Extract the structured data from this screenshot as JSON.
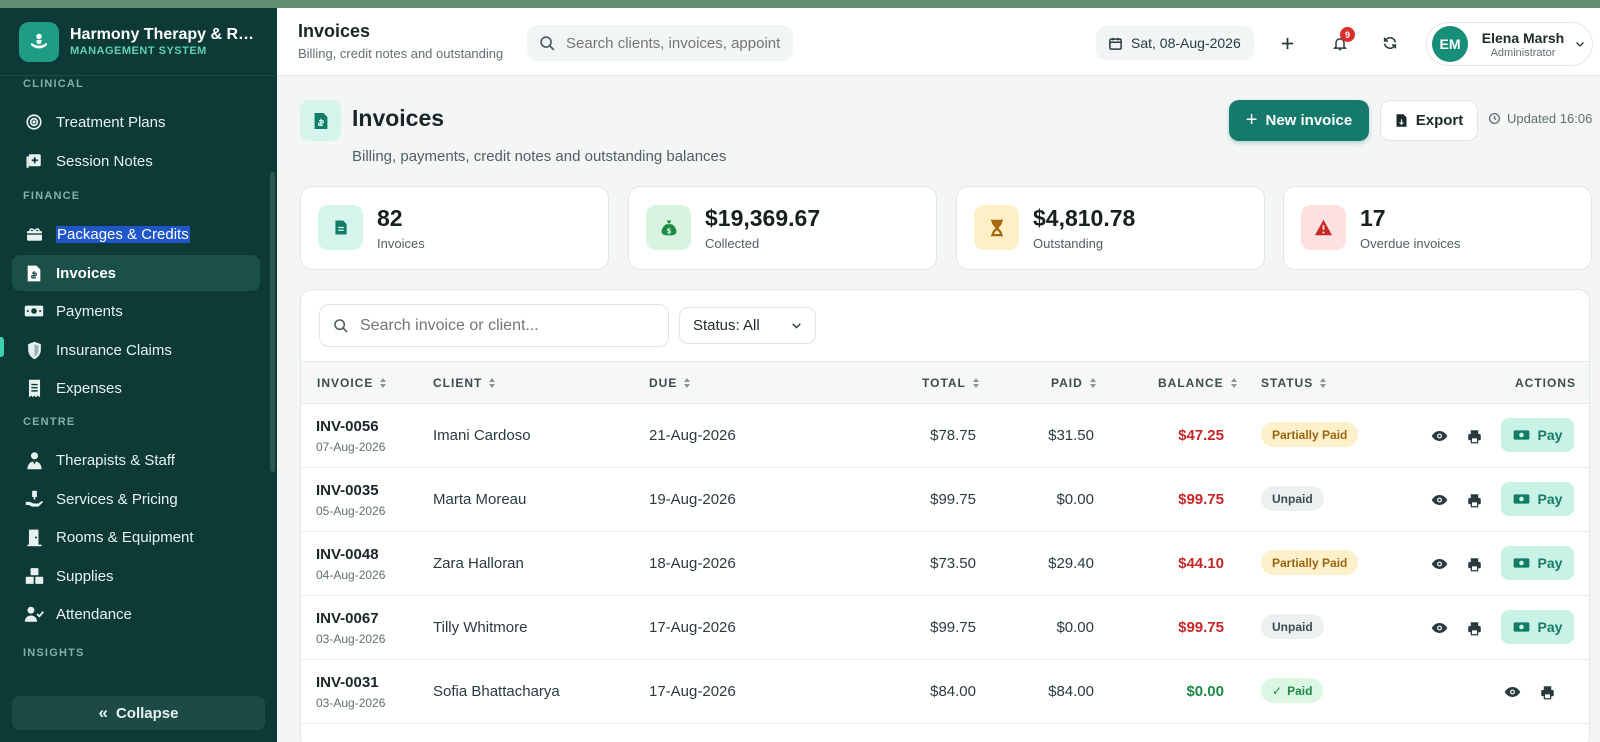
{
  "app": {
    "name": "Harmony Therapy & Re...",
    "subtitle": "MANAGEMENT SYSTEM"
  },
  "sidebar": {
    "sections": [
      {
        "title": "CLINICAL"
      },
      {
        "title": "FINANCE"
      },
      {
        "title": "CENTRE"
      },
      {
        "title": "INSIGHTS"
      }
    ],
    "items": [
      {
        "label": "Treatment Plans",
        "icon": "target-icon"
      },
      {
        "label": "Session Notes",
        "icon": "notes-icon"
      },
      {
        "label": "Packages & Credits",
        "icon": "gift-box-icon"
      },
      {
        "label": "Invoices",
        "icon": "invoice-icon"
      },
      {
        "label": "Payments",
        "icon": "cash-icon"
      },
      {
        "label": "Insurance Claims",
        "icon": "shield-icon"
      },
      {
        "label": "Expenses",
        "icon": "receipt-icon"
      },
      {
        "label": "Therapists & Staff",
        "icon": "staff-icon"
      },
      {
        "label": "Services & Pricing",
        "icon": "hand-coin-icon"
      },
      {
        "label": "Rooms & Equipment",
        "icon": "door-icon"
      },
      {
        "label": "Supplies",
        "icon": "boxes-icon"
      },
      {
        "label": "Attendance",
        "icon": "user-check-icon"
      }
    ],
    "active_item": "Invoices",
    "collapse_label": "Collapse"
  },
  "header": {
    "title": "Invoices",
    "subtitle": "Billing, credit notes and outstanding",
    "search_placeholder": "Search clients, invoices, appointments...",
    "date": "Sat, 08-Aug-2026",
    "notification_count": "9",
    "user": {
      "initials": "EM",
      "name": "Elena Marsh",
      "role": "Administrator"
    }
  },
  "page": {
    "title": "Invoices",
    "subtitle": "Billing, payments, credit notes and outstanding balances",
    "new_button": "New invoice",
    "export_button": "Export",
    "updated": "Updated 16:06"
  },
  "stats": [
    {
      "value": "82",
      "label": "Invoices",
      "icon": "document-icon",
      "bg": "#d5f4ec",
      "fg": "#137c67"
    },
    {
      "value": "$19,369.67",
      "label": "Collected",
      "icon": "money-bag-icon",
      "bg": "#d8f4e1",
      "fg": "#1c8a44"
    },
    {
      "value": "$4,810.78",
      "label": "Outstanding",
      "icon": "hourglass-icon",
      "bg": "#fdf0c6",
      "fg": "#a66a0d"
    },
    {
      "value": "17",
      "label": "Overdue invoices",
      "icon": "warning-icon",
      "bg": "#fde0e0",
      "fg": "#c62828"
    }
  ],
  "table": {
    "search_placeholder": "Search invoice or client...",
    "status_filter": "Status: All",
    "columns": [
      "INVOICE",
      "CLIENT",
      "DUE",
      "TOTAL",
      "PAID",
      "BALANCE",
      "STATUS",
      "ACTIONS"
    ],
    "pay_label": "Pay",
    "rows": [
      {
        "invoice": "INV-0056",
        "issued": "07-Aug-2026",
        "client": "Imani Cardoso",
        "due": "21-Aug-2026",
        "total": "$78.75",
        "paid": "$31.50",
        "balance": "$47.25",
        "status": "Partially Paid"
      },
      {
        "invoice": "INV-0035",
        "issued": "05-Aug-2026",
        "client": "Marta Moreau",
        "due": "19-Aug-2026",
        "total": "$99.75",
        "paid": "$0.00",
        "balance": "$99.75",
        "status": "Unpaid"
      },
      {
        "invoice": "INV-0048",
        "issued": "04-Aug-2026",
        "client": "Zara Halloran",
        "due": "18-Aug-2026",
        "total": "$73.50",
        "paid": "$29.40",
        "balance": "$44.10",
        "status": "Partially Paid"
      },
      {
        "invoice": "INV-0067",
        "issued": "03-Aug-2026",
        "client": "Tilly Whitmore",
        "due": "17-Aug-2026",
        "total": "$99.75",
        "paid": "$0.00",
        "balance": "$99.75",
        "status": "Unpaid"
      },
      {
        "invoice": "INV-0031",
        "issued": "03-Aug-2026",
        "client": "Sofia Bhattacharya",
        "due": "17-Aug-2026",
        "total": "$84.00",
        "paid": "$84.00",
        "balance": "$0.00",
        "status": "Paid"
      }
    ]
  },
  "colors": {
    "sidebar_bg": "#0d3a36",
    "accent": "#15796b",
    "balance_due": "#c62828",
    "balance_clear": "#1c8a44"
  }
}
